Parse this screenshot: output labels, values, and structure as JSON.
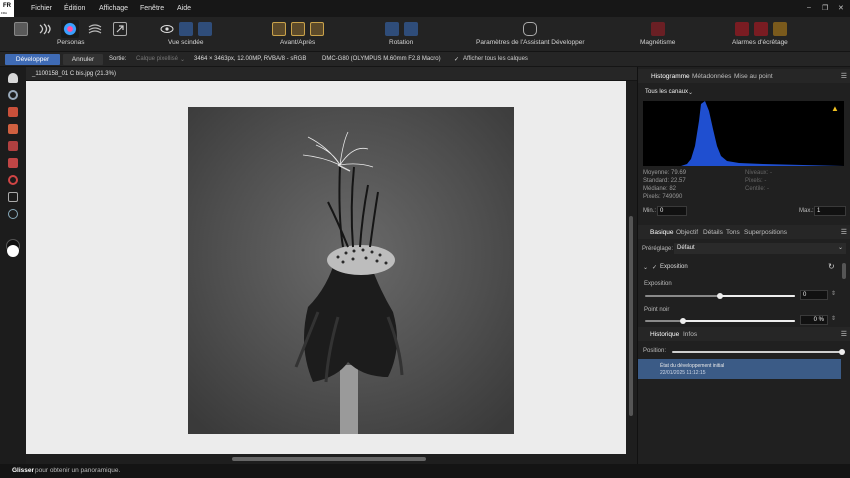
{
  "app": {
    "lang_badge": "FR",
    "lang_sub": "FRA"
  },
  "menu": [
    "Fichier",
    "Édition",
    "Affichage",
    "Fenêtre",
    "Aide"
  ],
  "toolbar": {
    "personas_label": "Personas",
    "split_view_label": "Vue scindée",
    "before_after_label": "Avant/Après",
    "rotation_label": "Rotation",
    "assistant_label": "Paramètres de l'Assistant Développer",
    "magnetism_label": "Magnétisme",
    "clipping_label": "Alarmes d'écrêtage"
  },
  "context_bar": {
    "develop_button": "Développer",
    "cancel_button": "Annuler",
    "output_label": "Sortie:",
    "output_value": "Calque pixellisé",
    "image_info": "3464 × 3463px, 12.00MP, RVBA/8 - sRGB",
    "camera_info": "DMC-G80 (OLYMPUS M.60mm F2.8 Macro)",
    "show_layers_label": "Afficher tous les calques"
  },
  "document": {
    "tab_title": "_1100158_01 C bis.jpg (21.3%)"
  },
  "status": {
    "bold": "Glisser",
    "text": "pour obtenir un panoramique."
  },
  "histogram_panel": {
    "tabs": [
      "Histogramme",
      "Métadonnées",
      "Mise au point"
    ],
    "channel_select": "Tous les canaux",
    "stats_left": [
      "Moyenne: 79.69",
      "Standard: 22.57",
      "Médiane: 82",
      "Pixels: 749090"
    ],
    "stats_right": [
      "Niveaux: -",
      "Pixels: -",
      "Centile: -"
    ],
    "min_label": "Min.:",
    "min_value": "0",
    "max_label": "Max.:",
    "max_value": "1",
    "warning_color": "#f0c020",
    "histogram_color": "#1f4fd0"
  },
  "basic_panel": {
    "tabs": [
      "Basique",
      "Objectif",
      "Détails",
      "Tons",
      "Superpositions"
    ],
    "preset_label": "Préréglage:",
    "preset_value": "Défaut",
    "section_title": "Exposition",
    "exposure_label": "Exposition",
    "exposure_value": "0",
    "exposure_level": 0.5,
    "black_point_label": "Point noir",
    "black_point_value": "0 %",
    "black_point_level": 0.25
  },
  "history_panel": {
    "tabs": [
      "Historique",
      "Infos"
    ],
    "position_label": "Position:",
    "entry_title": "État du développement initial",
    "entry_date": "22/01/2025 11:12:15"
  },
  "colors": {
    "accent": "#3f6bb5",
    "selection": "#3b5b86"
  }
}
